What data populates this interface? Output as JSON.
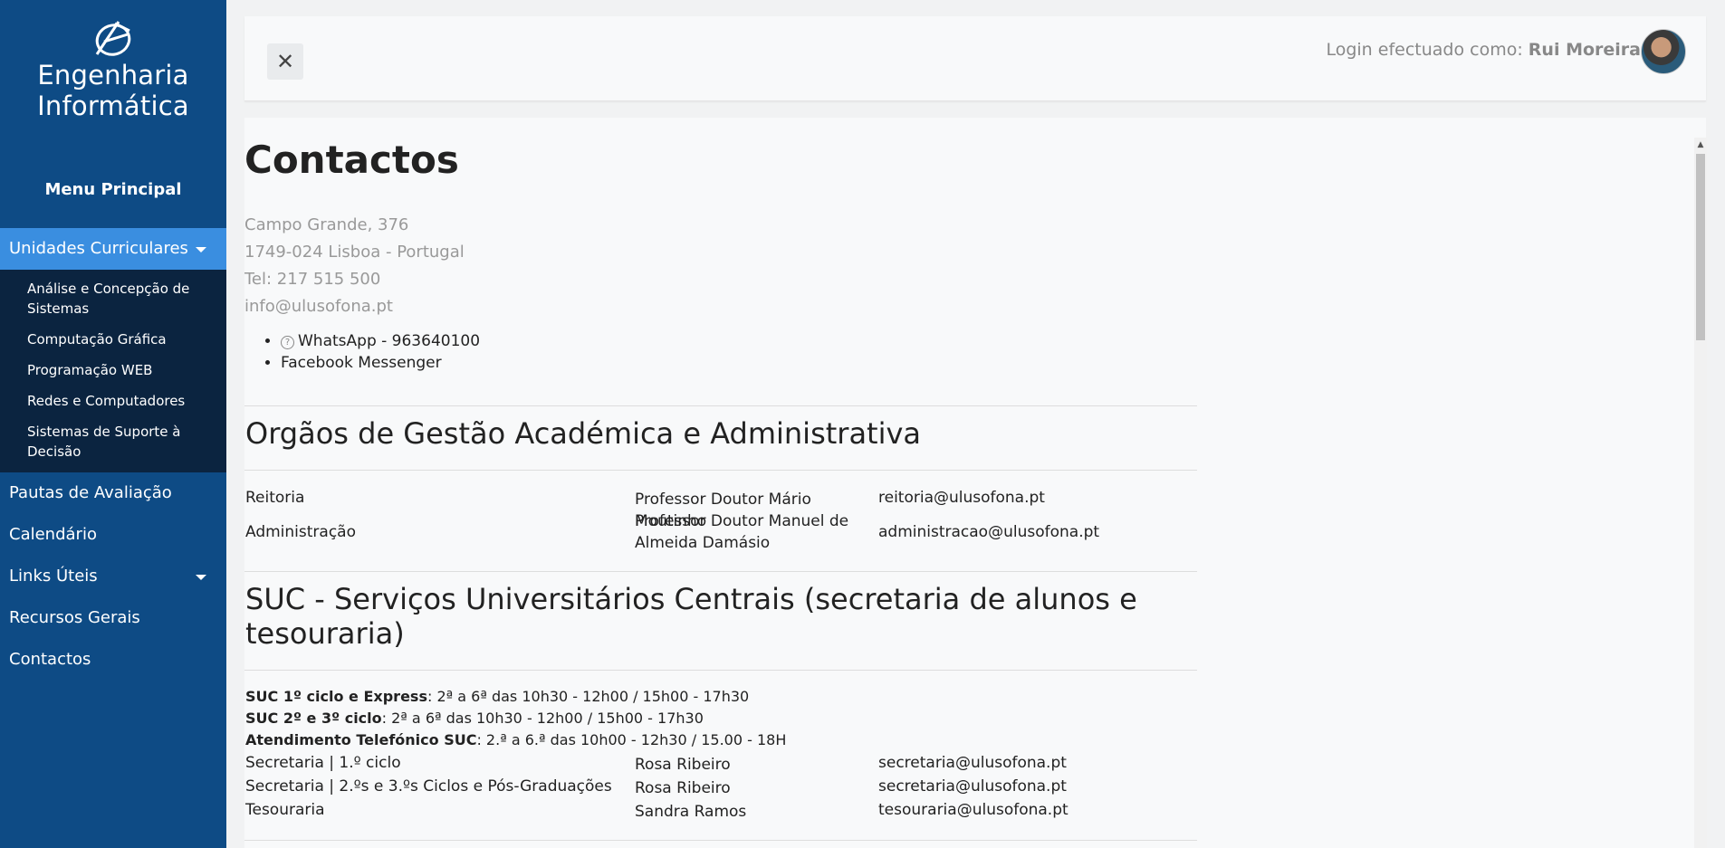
{
  "sidebar": {
    "logo_line1": "Engenharia",
    "logo_line2": "Informática",
    "menu_title": "Menu Principal",
    "items": [
      {
        "label": "Unidades Curriculares",
        "active": true,
        "has_caret": true,
        "children": [
          "Análise e Concepção de Sistemas",
          "Computação Gráfica",
          "Programação WEB",
          "Redes e Computadores",
          "Sistemas de Suporte à Decisão"
        ]
      },
      {
        "label": "Pautas de Avaliação"
      },
      {
        "label": "Calendário"
      },
      {
        "label": "Links Úteis",
        "has_caret": true
      },
      {
        "label": "Recursos Gerais"
      },
      {
        "label": "Contactos"
      }
    ]
  },
  "header": {
    "close_icon": "close-icon",
    "login_prefix": "Login efectuado como: ",
    "user_name": "Rui Moreira"
  },
  "page": {
    "title": "Contactos",
    "address": [
      "Campo Grande, 376",
      "1749-024 Lisboa - Portugal",
      "Tel: 217 515 500",
      "info@ulusofona.pt"
    ],
    "bullets": [
      "WhatsApp - 963640100",
      "Facebook Messenger"
    ],
    "section1": {
      "title": "Orgãos de Gestão Académica e Administrativa",
      "rows": [
        [
          "Reitoria",
          "Professor Doutor Mário Moutinho",
          "reitoria@ulusofona.pt"
        ],
        [
          "Administração",
          "Professor Doutor Manuel de Almeida Damásio",
          "administracao@ulusofona.pt"
        ]
      ]
    },
    "section2": {
      "title": "SUC - Serviços Universitários Centrais (secretaria de alunos e tesouraria)",
      "schedule": [
        {
          "label": "SUC 1º ciclo e Express",
          "text": ": 2ª a 6ª das 10h30 - 12h00 / 15h00 - 17h30"
        },
        {
          "label": "SUC 2º e 3º ciclo",
          "text": ": 2ª a 6ª das 10h30 - 12h00 / 15h00 - 17h30"
        },
        {
          "label": "Atendimento Telefónico SUC",
          "text": ": 2.ª a 6.ª das 10h00 - 12h30 / 15.00 - 18H"
        }
      ],
      "rows": [
        [
          "Secretaria | 1.º ciclo",
          "Rosa Ribeiro",
          "secretaria@ulusofona.pt"
        ],
        [
          "Secretaria | 2.ºs e 3.ºs Ciclos e Pós-Graduações",
          "Rosa Ribeiro",
          "secretaria@ulusofona.pt"
        ],
        [
          "Tesouraria",
          "Sandra Ramos",
          "tesouraria@ulusofona.pt"
        ]
      ]
    }
  },
  "colors": {
    "sidebar": "#0e4b85",
    "active": "#3a8ee0",
    "submenu": "#0b2440"
  }
}
